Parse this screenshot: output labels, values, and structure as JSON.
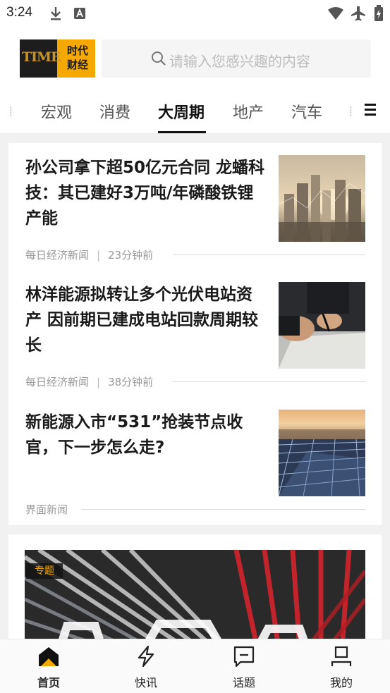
{
  "status_bar": {
    "time": "3:24"
  },
  "header": {
    "logo_mark": "TIME",
    "logo_cn_line1": "时代",
    "logo_cn_line2": "财经",
    "search_placeholder": "请输入您感兴趣的内容"
  },
  "tabs": {
    "items": [
      "宏观",
      "消费",
      "大周期",
      "地产",
      "汽车"
    ],
    "active": "大周期"
  },
  "articles": [
    {
      "title": "孙公司拿下超50亿元合同 龙蟠科技：其已建好3万吨/年磷酸铁锂产能",
      "source": "每日经济新闻",
      "time": "23分钟前",
      "image": "city-skyline-photo"
    },
    {
      "title": "林洋能源拟转让多个光伏电站资产 因前期已建成电站回款周期较长",
      "source": "每日经济新闻",
      "time": "38分钟前",
      "image": "signing-document-photo"
    },
    {
      "title": "新能源入市“531”抢装节点收官，下一步怎么走?",
      "source": "界面新闻",
      "time": "",
      "image": "solar-panels-photo"
    }
  ],
  "topic": {
    "badge": "专题"
  },
  "bottom_nav": {
    "items": [
      "首页",
      "快讯",
      "话题",
      "我的"
    ],
    "active": "首页"
  },
  "colors": {
    "accent": "#f5a800",
    "logo_dark": "#1d1d1d",
    "text": "#1a1a1a",
    "muted": "#999999"
  }
}
